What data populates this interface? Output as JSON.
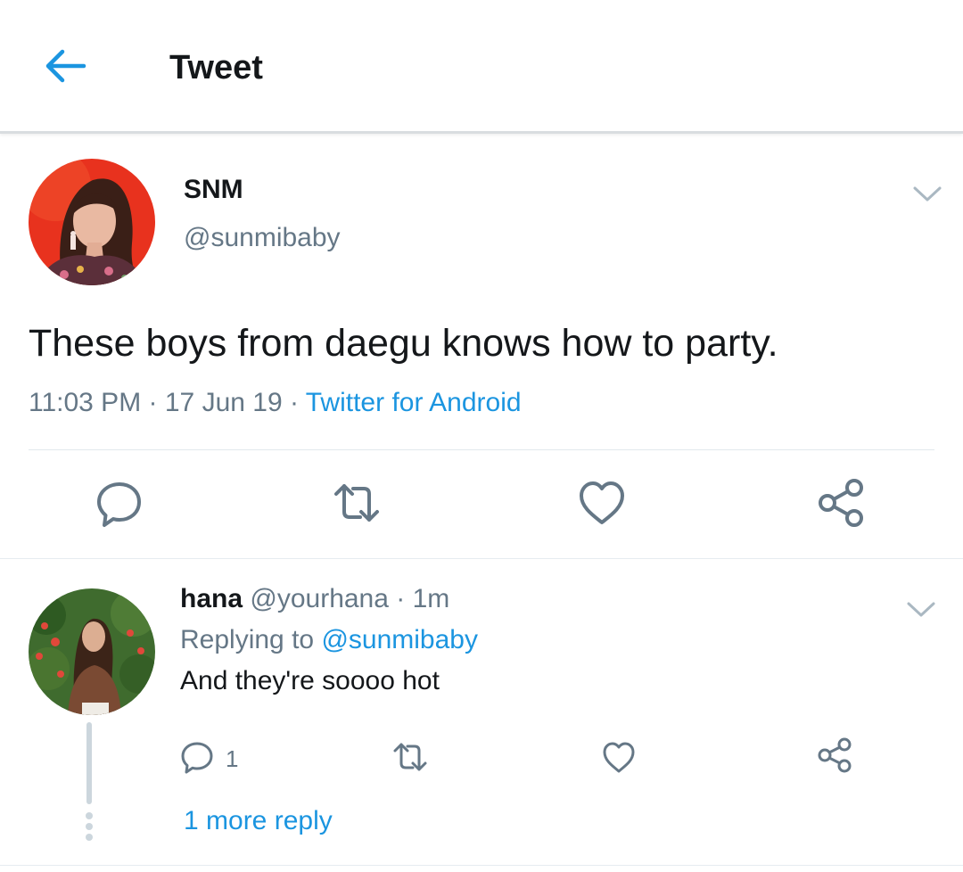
{
  "header": {
    "title": "Tweet",
    "back_icon": "arrow-left-icon"
  },
  "tweet": {
    "display_name": "SNM",
    "handle": "@sunmibaby",
    "text": "These boys from daegu knows how to party.",
    "time": "11:03 PM",
    "date": "17 Jun 19",
    "source": "Twitter for Android",
    "separator": " · ",
    "actions": [
      "reply-icon",
      "retweet-icon",
      "like-icon",
      "share-icon"
    ]
  },
  "reply": {
    "display_name": "hana",
    "handle": "@yourhana",
    "age": "1m",
    "replying_prefix": "Replying to ",
    "replying_to": "@sunmibaby",
    "text": "And they're soooo hot",
    "reply_count": "1",
    "more_replies": "1 more reply"
  },
  "colors": {
    "accent": "#1b95e0",
    "secondary_text": "#657786",
    "divider": "#e1e8ed"
  }
}
